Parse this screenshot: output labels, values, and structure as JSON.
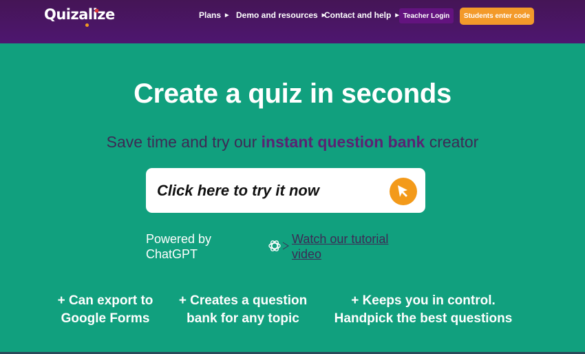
{
  "header": {
    "logo": "Quizalize",
    "nav": [
      {
        "label": "Plans",
        "icon": "caret-right-icon"
      },
      {
        "label": "Demo and resources",
        "icon": "caret-right-icon"
      },
      {
        "label": "Contact and help",
        "icon": "caret-right-icon"
      }
    ],
    "teacher_login": "Teacher Login",
    "students_enter_code": "Students enter code"
  },
  "hero": {
    "title": "Create a quiz in seconds",
    "subtitle_pre": "Save time and try our ",
    "subtitle_bold": "instant question bank",
    "subtitle_post": " creator",
    "cta_label": "Click here to try it now",
    "cta_icon": "cursor-arrow-icon",
    "powered_line1": "Powered by",
    "powered_line2": "ChatGPT",
    "tutorial_link": "Watch our tutorial video"
  },
  "features": [
    {
      "line1": "+ Can export to",
      "line2": "Google Forms"
    },
    {
      "line1": "+ Creates a question",
      "line2": "bank for any topic"
    },
    {
      "line1": "+ Keeps you in control.",
      "line2": "Handpick the best questions"
    }
  ],
  "colors": {
    "header_bg": "#4a1563",
    "hero_bg": "#11a07e",
    "accent_orange": "#f39a2a",
    "teacher_btn": "#63137f",
    "subtitle_text": "#3d2a55"
  }
}
